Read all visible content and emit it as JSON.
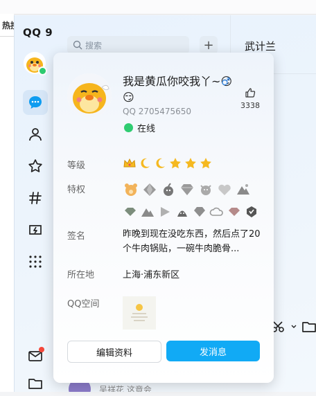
{
  "app": {
    "logo": "QQ 9",
    "hot_label": "热搜"
  },
  "search": {
    "placeholder": "搜索"
  },
  "chat": {
    "title": "武计兰",
    "list_item_name": "吴祥花  这竟会  都留"
  },
  "profile": {
    "nickname": "我是黄瓜你咬我丫~😏😏",
    "gender_symbol": "♂",
    "likes": "3338",
    "qq_number": "QQ 2705475650",
    "status": "在线",
    "level_label": "等级",
    "privilege_label": "特权",
    "signature_label": "签名",
    "signature": "昨晚到现在没吃东西，然后点了20个牛肉锅贴，一碗牛肉脆骨...",
    "location_label": "所在地",
    "location": "上海·浦东新区",
    "zone_label": "QQ空间",
    "edit_button": "编辑资料",
    "message_button": "发消息"
  },
  "level_icons": [
    "crown-icon",
    "moon-icon",
    "moon-icon",
    "star-icon",
    "star-icon",
    "star-icon"
  ],
  "privilege_icons_row1": [
    "bear-badge-icon",
    "diamond-icon",
    "bomb-icon",
    "diamond-icon",
    "face-icon",
    "heart-icon",
    "mountain-icon"
  ],
  "privilege_icons_row2": [
    "gem-icon",
    "mountain-icon",
    "play-icon",
    "bomb-icon",
    "diamond-icon",
    "cloud-icon",
    "gem-icon",
    "badge-icon"
  ],
  "nav_icons": [
    "chat-icon",
    "contacts-icon",
    "star-icon",
    "hashtag-icon",
    "game-icon",
    "apps-icon",
    "mail-icon",
    "folder-icon"
  ],
  "colors": {
    "accent": "#11aaf5",
    "online": "#2fcc71",
    "gender": "#3b8ce6",
    "badge": "#f5483b"
  }
}
